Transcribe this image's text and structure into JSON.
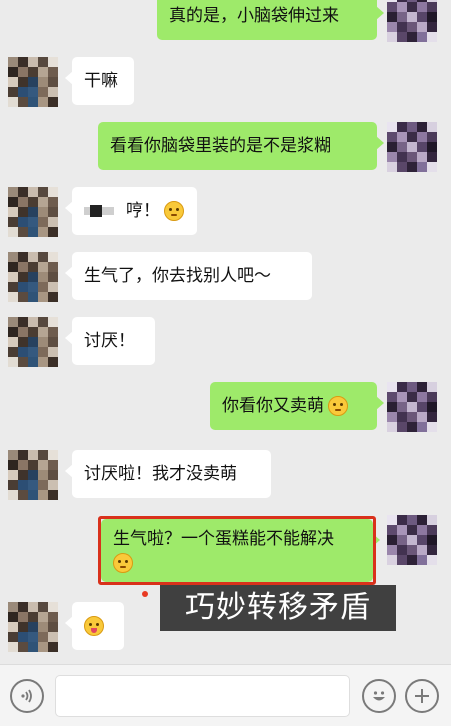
{
  "messages": [
    {
      "id": "m1",
      "side": "out",
      "text": "真的是，小脑袋伸过来"
    },
    {
      "id": "m2",
      "side": "in",
      "text": "干嘛"
    },
    {
      "id": "m3",
      "side": "out",
      "text": "看看你脑袋里装的是不是浆糊"
    },
    {
      "id": "m4",
      "side": "in",
      "text": "哼！",
      "redacted_prefix": true,
      "emoji": "thinking-face"
    },
    {
      "id": "m5",
      "side": "in",
      "text": "生气了，你去找别人吧～"
    },
    {
      "id": "m6",
      "side": "in",
      "text": "讨厌！"
    },
    {
      "id": "m7",
      "side": "out",
      "text": "你看你又卖萌",
      "emoji": "dizzy-face"
    },
    {
      "id": "m8",
      "side": "in",
      "text": "讨厌啦！我才没卖萌"
    },
    {
      "id": "m9",
      "side": "out",
      "text": "生气啦？一个蛋糕能不能解决",
      "emoji": "thinking-face"
    },
    {
      "id": "m10",
      "side": "in",
      "text": "",
      "emoji": "tongue-face"
    }
  ],
  "annotation": {
    "caption": "巧妙转移矛盾",
    "highlight_color": "#d9311b"
  },
  "input_bar": {
    "input_value": "",
    "voice_icon": "voice-icon",
    "emoji_icon": "emoji-icon",
    "plus_icon": "plus-icon"
  },
  "colors": {
    "background": "#ebebeb",
    "outgoing_bubble": "#9eea6a",
    "incoming_bubble": "#ffffff"
  }
}
